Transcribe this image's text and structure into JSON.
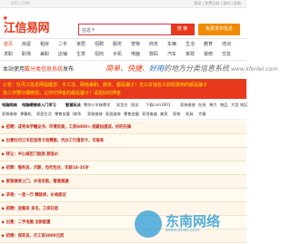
{
  "topbar": {
    "site_url": "0351.COM",
    "links": "登录 | 免费注册 | 我的 | 帮助"
  },
  "header": {
    "logo_text": "江信易网",
    "search_scope": "信息",
    "search_placeholder": "",
    "search_button": "搜 索",
    "post_button": "免费发布信息"
  },
  "nav": {
    "row1": [
      "首页",
      "房屋",
      "租房",
      "二手",
      "家居",
      "招聘",
      "服务",
      "宠物",
      "商务",
      "车辆",
      "生活",
      "教育",
      "培训"
    ],
    "row2": [
      "求职",
      "职场",
      "兼职",
      "店铺",
      "生意",
      "招商",
      "手机",
      "电脑",
      "数码",
      "汽车",
      "家政",
      "装修",
      "交友"
    ]
  },
  "banner": {
    "left_prefix": "本站使用",
    "left_highlight": "戴分类信息系统",
    "left_suffix": "发布",
    "right_brand1": "简单",
    "right_brand2": "快捷",
    "right_brand3": "好用",
    "right_tail": "的地方分类信息系统",
    "url": "www.kfenlei.com"
  },
  "notice": {
    "line1": "公告：牡丹江信息网提醒您：手工活、网络兼职、刷单、都是骗子！无以本钱名义收取费用的都是骗子",
    "line2": "找工作要仔细辨别，让你付押金的都是骗子！请找好的押金"
  },
  "categories": {
    "row1": [
      "电脑网络",
      "电脑硬维修入门学习",
      "智慧玩法",
      "教你小学妹教学",
      "发货方",
      "阳龙",
      "下载csm1001",
      "家装维修",
      "在线",
      "弹力",
      "物品",
      "大型",
      "地区"
    ],
    "row2": [
      "家装维修",
      "弹簧机",
      "家居生活",
      "零售加盟（联系",
      "家装维修",
      "家居维修",
      "零售加盟",
      "家用电器",
      "美家",
      "家装",
      "家具",
      "大厦"
    ]
  },
  "listings": [
    "▶ 招聘：成考本学籍证书，环境优美，工资6000+ 底薪加提成，好的先锋",
    "▶ 出售牡丹江市区信用卡消费额，代办工行借贷卡，可联系",
    "▶ 转让：中心城区门脸房 超低价",
    "▶ 招聘：服务员，月薪，包吃包住，年龄18-35岁",
    "▶ 家装维修上门，水电安装，管道疏通",
    "▶ 求租：一室一厅 精装修，价格面议",
    "▶ 招聘：送餐员 多名，工资日结",
    "▶ 出售：二手电脑 全新配置",
    "▶ 招聘：保安员，月工资3000元起",
    "▶ 转让：冷饮店 位置好 客流量大"
  ],
  "watermark": {
    "text": "东南网络",
    "sub": "www.dnwl.com"
  },
  "colors": {
    "brand_red": "#e8381b",
    "notice_yellow": "#ffe600",
    "post_orange": "#f08a00",
    "accent_blue": "#2b9bd6"
  }
}
